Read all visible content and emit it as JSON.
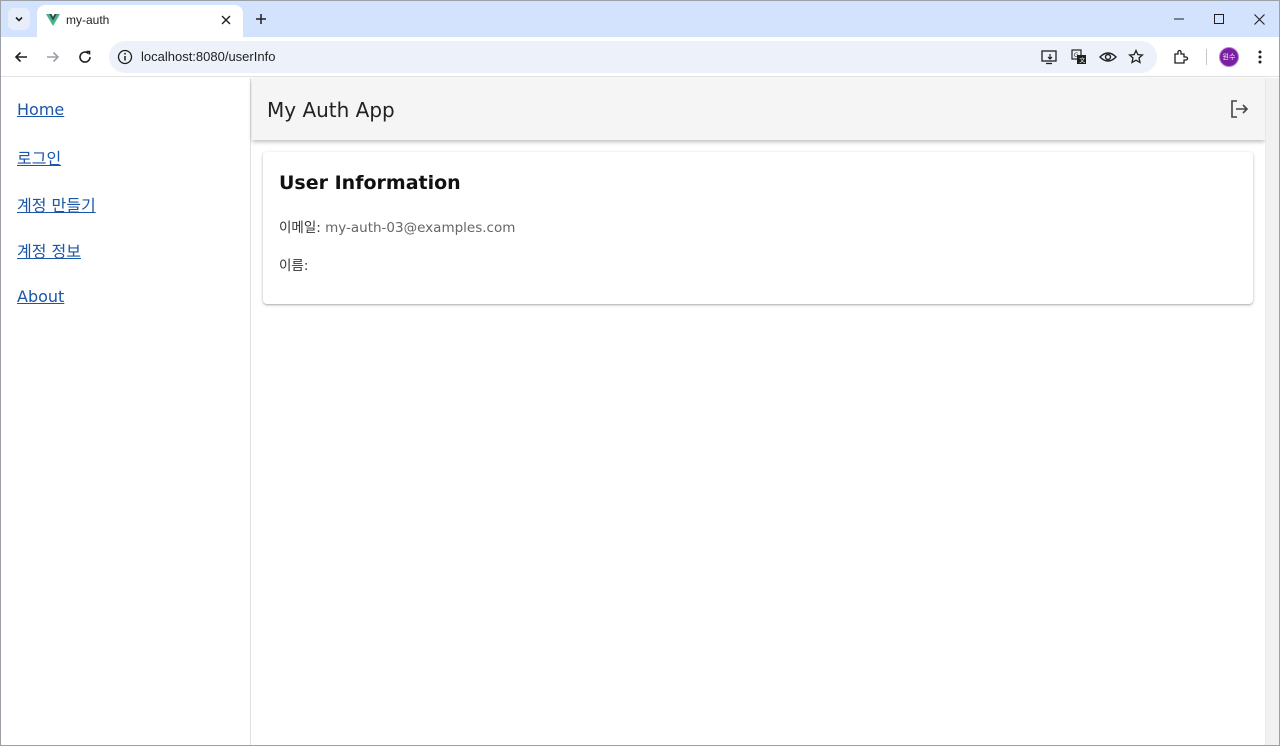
{
  "browser": {
    "tab_title": "my-auth",
    "url": "localhost:8080/userInfo",
    "avatar_text": "원수",
    "colors": {
      "tabstrip": "#d3e3fd",
      "omnibox": "#edf2fa",
      "avatar": "#7b1fa2"
    }
  },
  "sidebar": {
    "items": [
      {
        "label": "Home"
      },
      {
        "label": "로그인"
      },
      {
        "label": "계정 만들기"
      },
      {
        "label": "계정 정보"
      },
      {
        "label": "About"
      }
    ],
    "link_color": "#1a56a8"
  },
  "appbar": {
    "title": "My Auth App",
    "logout_icon": "logout-icon"
  },
  "card": {
    "title": "User Information",
    "email_label": "이메일:",
    "email_value": "my-auth-03@examples.com",
    "name_label": "이름:",
    "name_value": ""
  }
}
